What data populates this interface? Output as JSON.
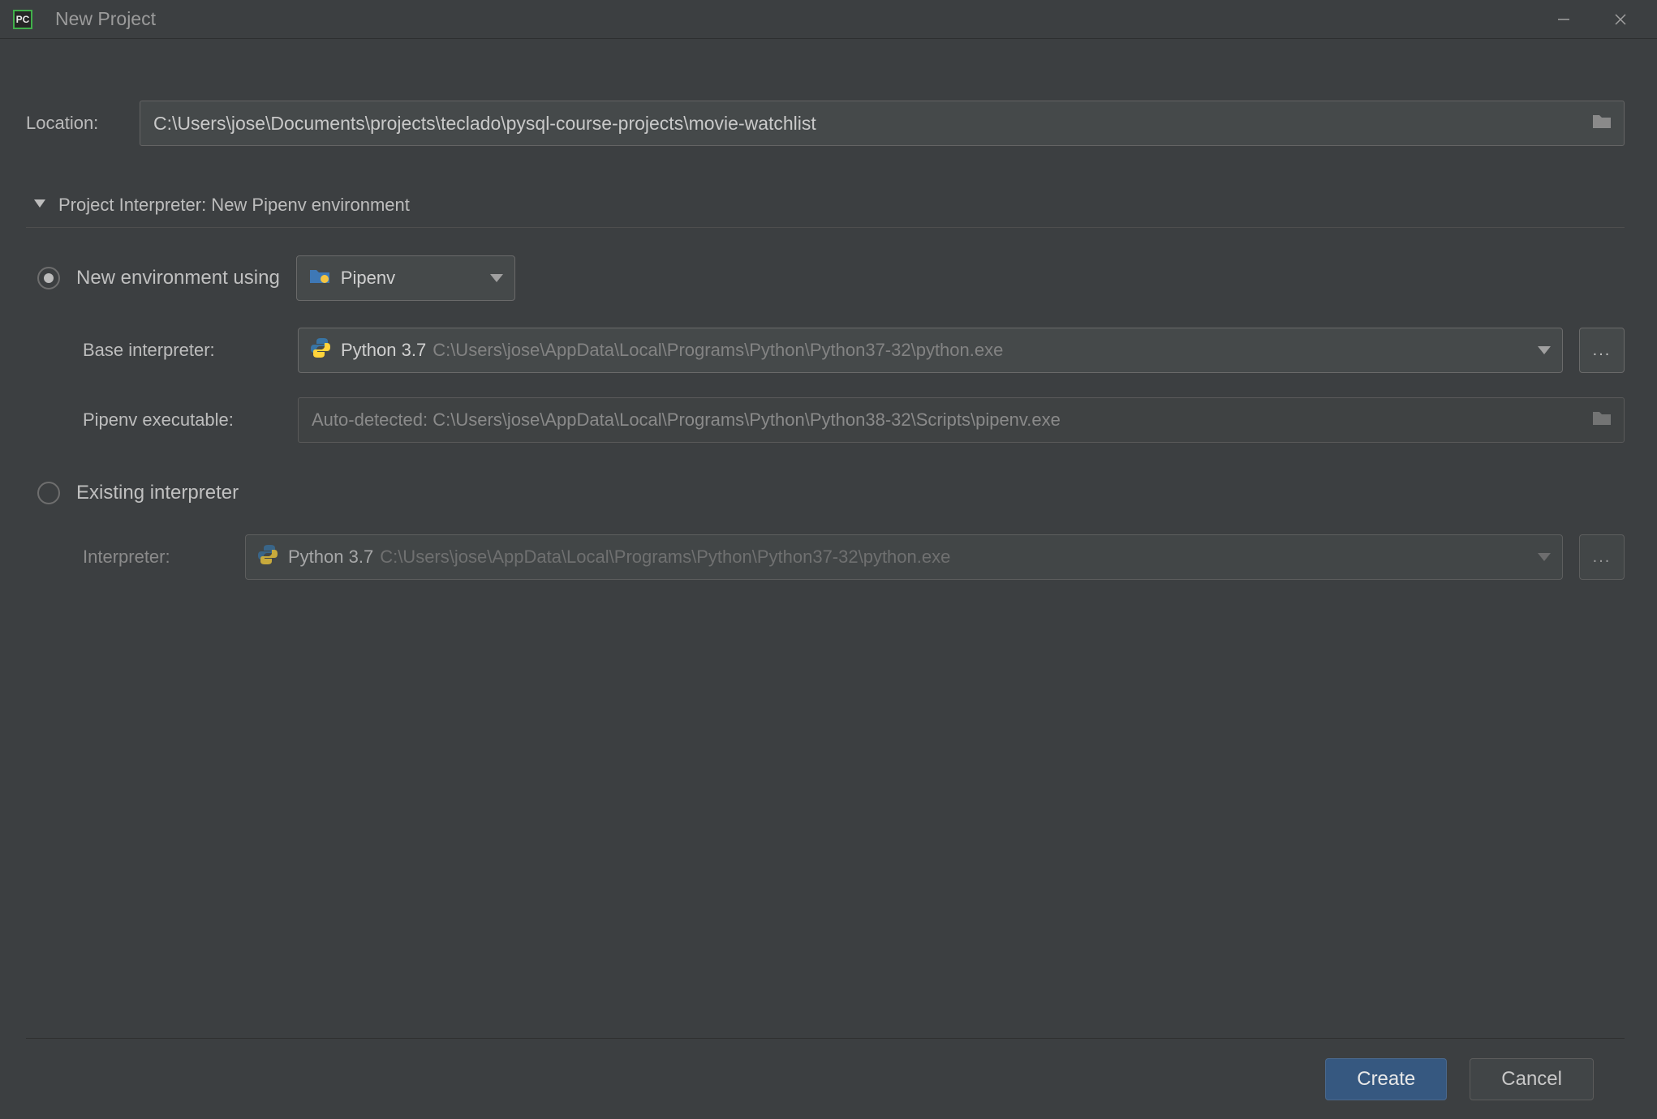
{
  "window": {
    "title": "New Project"
  },
  "location": {
    "label": "Location:",
    "value": "C:\\Users\\jose\\Documents\\projects\\teclado\\pysql-course-projects\\movie-watchlist"
  },
  "section": {
    "title": "Project Interpreter: New Pipenv environment"
  },
  "new_env": {
    "radio_label": "New environment using",
    "tool": "Pipenv",
    "base_interpreter_label": "Base interpreter:",
    "base_interpreter_name": "Python 3.7",
    "base_interpreter_path": "C:\\Users\\jose\\AppData\\Local\\Programs\\Python\\Python37-32\\python.exe",
    "pipenv_exe_label": "Pipenv executable:",
    "pipenv_exe_value": "Auto-detected: C:\\Users\\jose\\AppData\\Local\\Programs\\Python\\Python38-32\\Scripts\\pipenv.exe"
  },
  "existing": {
    "radio_label": "Existing interpreter",
    "interpreter_label": "Interpreter:",
    "interpreter_name": "Python 3.7",
    "interpreter_path": "C:\\Users\\jose\\AppData\\Local\\Programs\\Python\\Python37-32\\python.exe"
  },
  "footer": {
    "create": "Create",
    "cancel": "Cancel"
  },
  "ellipsis": "..."
}
